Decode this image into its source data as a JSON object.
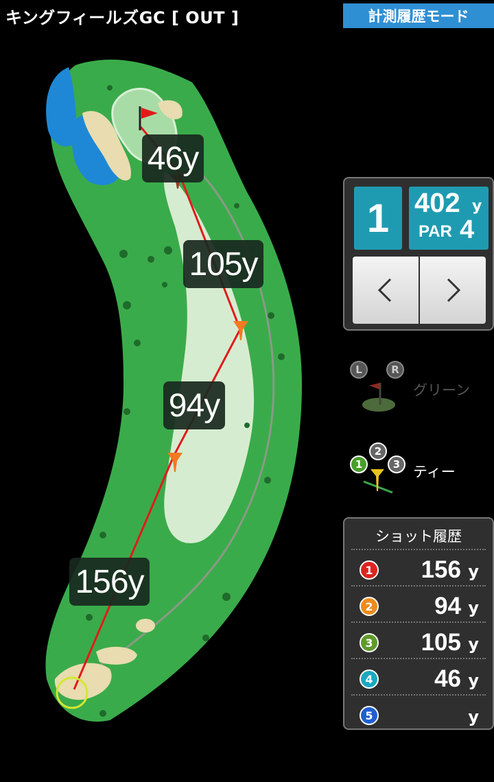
{
  "header": {
    "course_title": "キングフィールズGC [ OUT ]",
    "mode_button": "計測履歴モード"
  },
  "map": {
    "distance_labels": [
      "46y",
      "105y",
      "94y",
      "156y"
    ]
  },
  "hole": {
    "number": "1",
    "yardage": "402",
    "yard_unit": "y",
    "par_label": "PAR",
    "par_value": "4",
    "prev_icon": "chevron-left-icon",
    "next_icon": "chevron-right-icon"
  },
  "green_selector": {
    "left_badge": "L",
    "right_badge": "R",
    "label": "グリーン"
  },
  "tee_selector": {
    "badges": [
      "1",
      "2",
      "3"
    ],
    "label": "ティー"
  },
  "shot_history": {
    "title": "ショット履歴",
    "shots": [
      {
        "num": "1",
        "distance": "156",
        "unit": "y",
        "color": "#e0231f"
      },
      {
        "num": "2",
        "distance": "94",
        "unit": "y",
        "color": "#ef8b1c"
      },
      {
        "num": "3",
        "distance": "105",
        "unit": "y",
        "color": "#5f9a2a"
      },
      {
        "num": "4",
        "distance": "46",
        "unit": "y",
        "color": "#1aa9c0"
      },
      {
        "num": "5",
        "distance": "",
        "unit": "y",
        "color": "#1f5fd0"
      }
    ]
  },
  "colors": {
    "accent_blue": "#2f8fd3",
    "hole_teal": "#1f9bb1",
    "rough_green": "#3aab4a",
    "fairway": "#d6ecd0",
    "shot_line": "#e21a1a"
  }
}
